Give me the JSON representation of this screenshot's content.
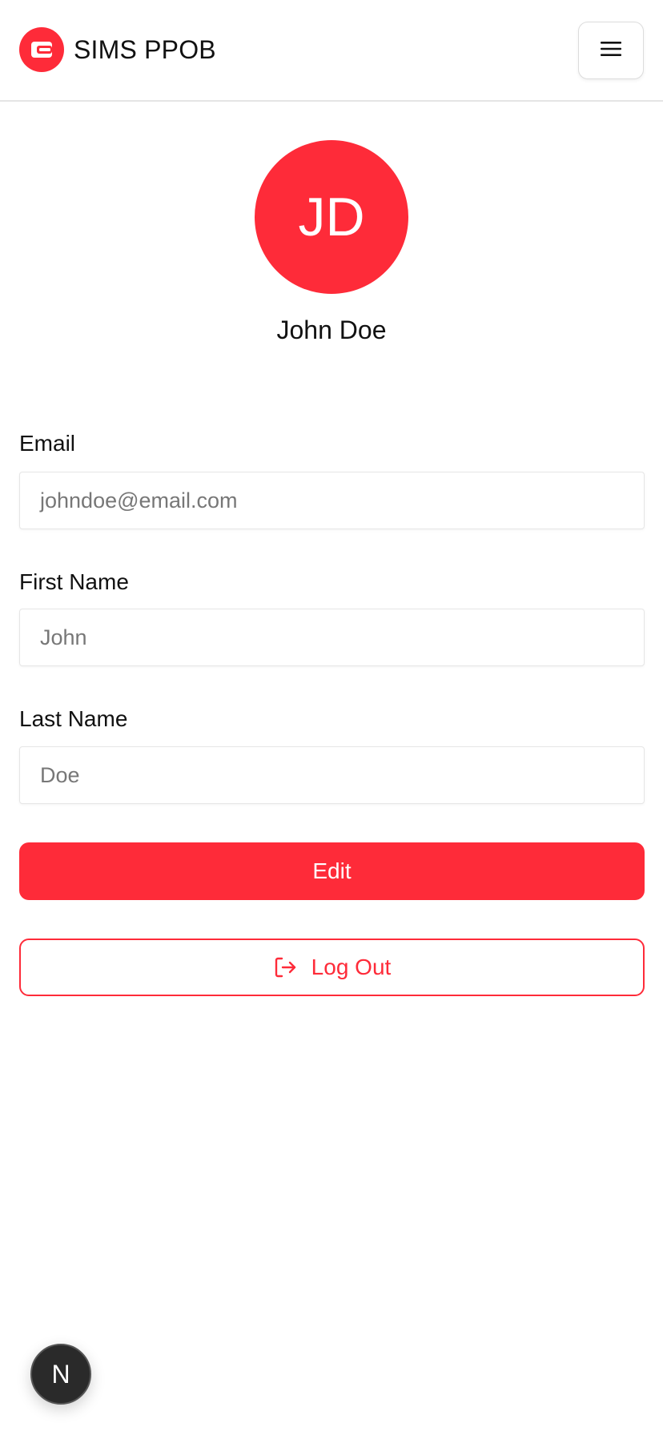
{
  "header": {
    "brand_name": "SIMS PPOB",
    "logo_icon": "wallet-icon",
    "menu_icon": "hamburger-menu-icon"
  },
  "profile": {
    "initials": "JD",
    "name": "John Doe"
  },
  "form": {
    "email_label": "Email",
    "email_placeholder": "johndoe@email.com",
    "first_name_label": "First Name",
    "first_name_placeholder": "John",
    "last_name_label": "Last Name",
    "last_name_placeholder": "Doe"
  },
  "actions": {
    "edit_label": "Edit",
    "logout_label": "Log Out",
    "logout_icon": "logout-icon"
  },
  "dev_badge": {
    "letter": "N"
  },
  "colors": {
    "accent": "#fe2b39",
    "background": "#ffffff",
    "text": "#111111",
    "input_placeholder": "#777777"
  }
}
